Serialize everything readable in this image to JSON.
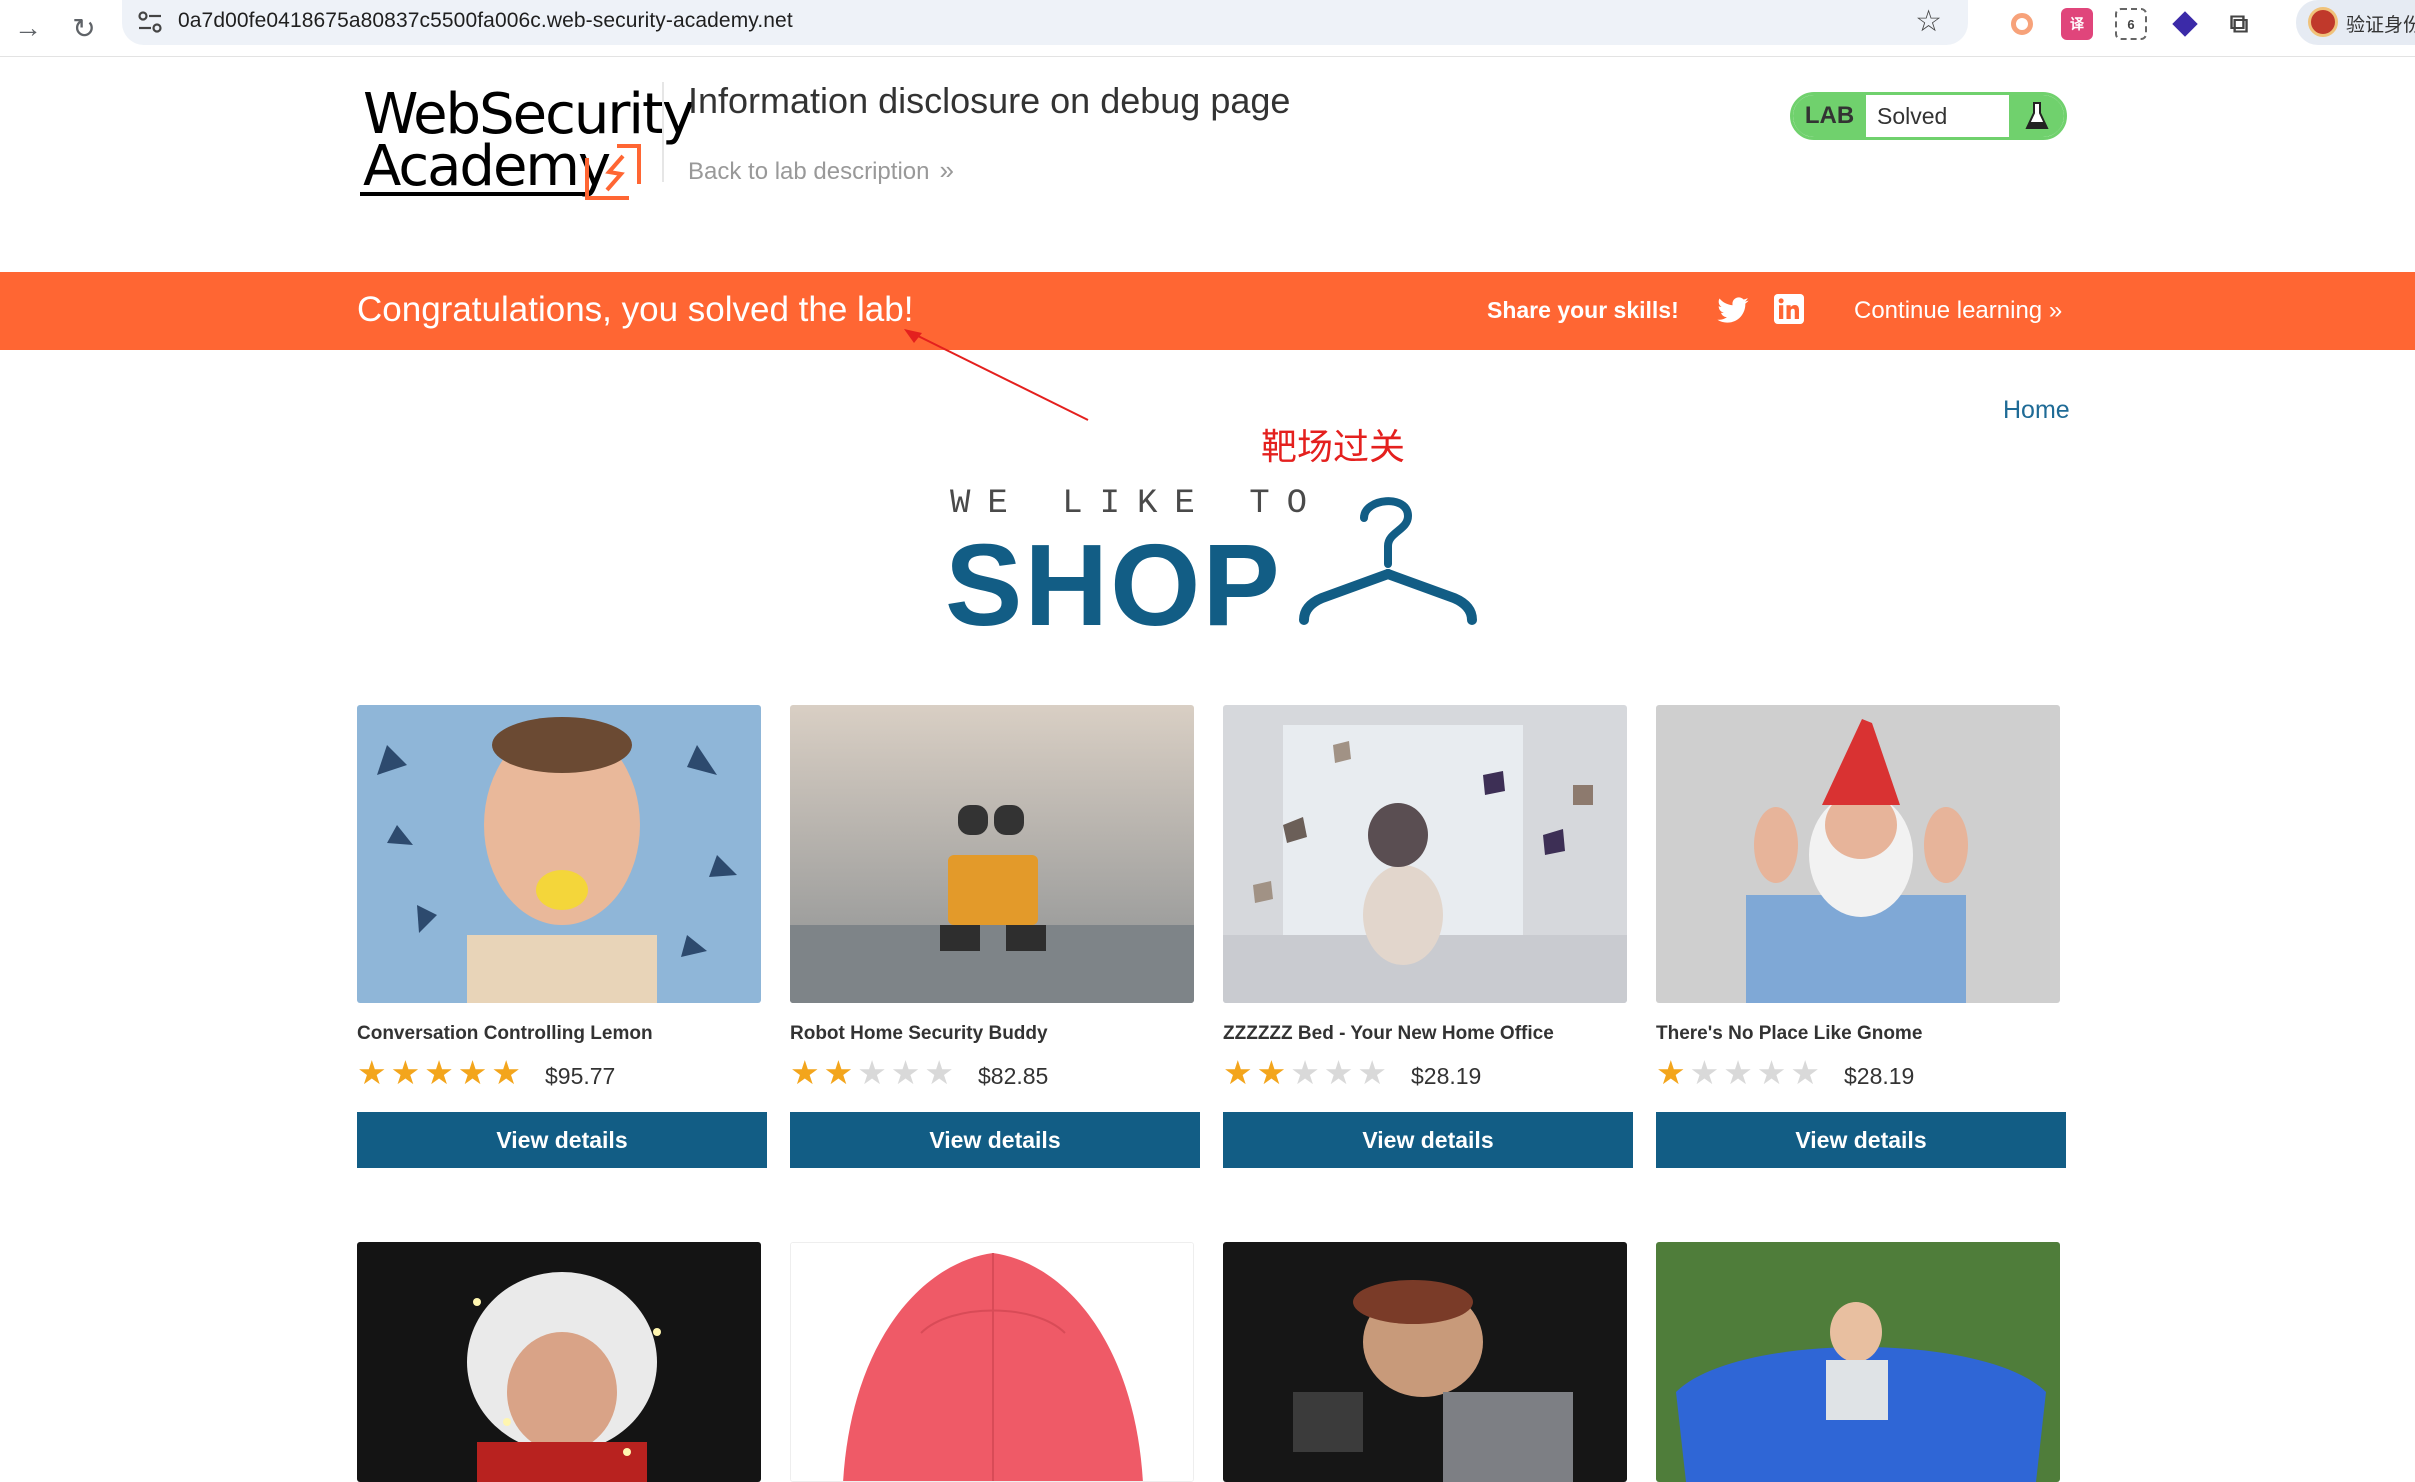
{
  "browser": {
    "url": "0a7d00fe0418675a80837c5500fa006c.web-security-academy.net",
    "profile_label": "验证身份"
  },
  "header": {
    "logo_line1": "WebSecurity",
    "logo_line2": "Academy",
    "lab_title": "Information disclosure on debug page",
    "back_link": "Back to lab description",
    "back_chevron": "»",
    "lab_tag": "LAB",
    "lab_status": "Solved"
  },
  "banner": {
    "message": "Congratulations, you solved the lab!",
    "share": "Share your skills!",
    "continue": "Continue learning",
    "continue_chevron": "»",
    "color": "#ff6633"
  },
  "annotation": {
    "text": "靶场过关",
    "color": "#e4201e"
  },
  "nav": {
    "home": "Home"
  },
  "shop_logo": {
    "tagline": "WE LIKE TO",
    "word": "SHOP",
    "color": "#125d85"
  },
  "products": [
    {
      "name": "Conversation Controlling Lemon",
      "rating": 5,
      "price": "$95.77",
      "button": "View details",
      "image": "lemon-man-photo"
    },
    {
      "name": "Robot Home Security Buddy",
      "rating": 2,
      "price": "$82.85",
      "button": "View details",
      "image": "robot-toy-photo"
    },
    {
      "name": "ZZZZZZ Bed - Your New Home Office",
      "rating": 2,
      "price": "$28.19",
      "button": "View details",
      "image": "flying-books-photo"
    },
    {
      "name": "There's No Place Like Gnome",
      "rating": 1,
      "price": "$28.19",
      "button": "View details",
      "image": "gnome-man-photo"
    }
  ],
  "products_row2": [
    {
      "image": "christmas-lights-photo"
    },
    {
      "image": "red-umbrella-photo"
    },
    {
      "image": "camera-puppet-photo"
    },
    {
      "image": "bean-bag-girl-photo"
    }
  ],
  "colors": {
    "accent": "#ff6633",
    "button": "#125d85",
    "lab_green": "#70d16d",
    "star": "#f3a51c"
  }
}
